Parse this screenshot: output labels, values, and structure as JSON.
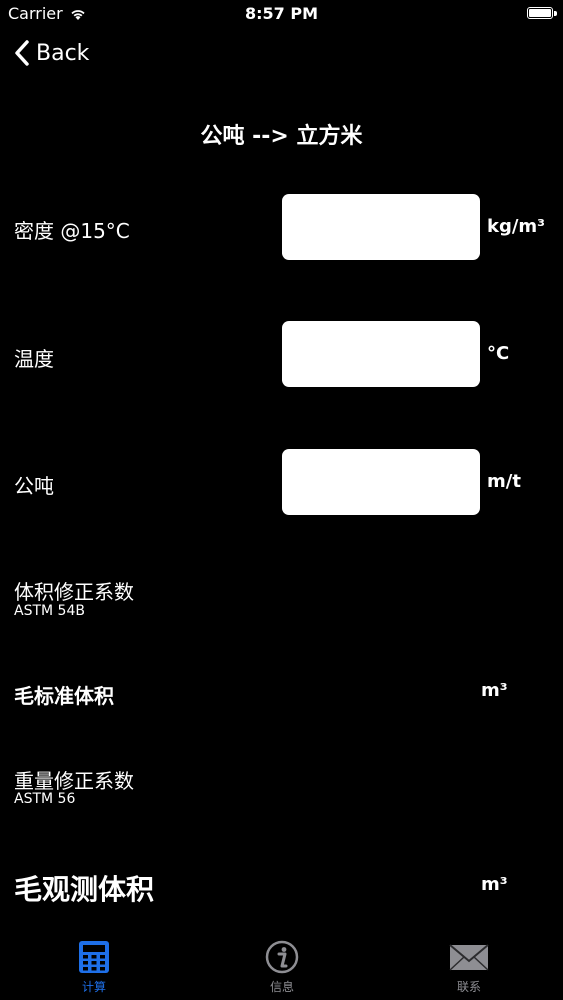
{
  "status_bar": {
    "carrier": "Carrier",
    "time": "8:57 PM"
  },
  "nav": {
    "back_label": "Back",
    "title": "公吨 --> 立方米"
  },
  "form": {
    "density": {
      "label": "密度 @15°C",
      "value": "",
      "unit": "kg/m³"
    },
    "temperature": {
      "label": "温度",
      "value": "",
      "unit": "°C"
    },
    "tonnes": {
      "label": "公吨",
      "value": "",
      "unit": "m/t"
    }
  },
  "results": {
    "vcf": {
      "label": "体积修正系数",
      "sub": "ASTM 54B"
    },
    "gsv": {
      "label": "毛标准体积",
      "unit": "m³"
    },
    "wcf": {
      "label": "重量修正系数",
      "sub": "ASTM 56"
    },
    "gov": {
      "label": "毛观测体积",
      "unit": "m³"
    }
  },
  "tabbar": {
    "tabs": [
      {
        "label": "计算",
        "icon": "calculator-icon",
        "active": true
      },
      {
        "label": "信息",
        "icon": "info-icon",
        "active": false
      },
      {
        "label": "联系",
        "icon": "envelope-icon",
        "active": false
      }
    ]
  },
  "colors": {
    "background": "#000000",
    "text": "#ffffff",
    "active_tab": "#1e6fe8",
    "inactive_tab": "#8e8e93"
  }
}
